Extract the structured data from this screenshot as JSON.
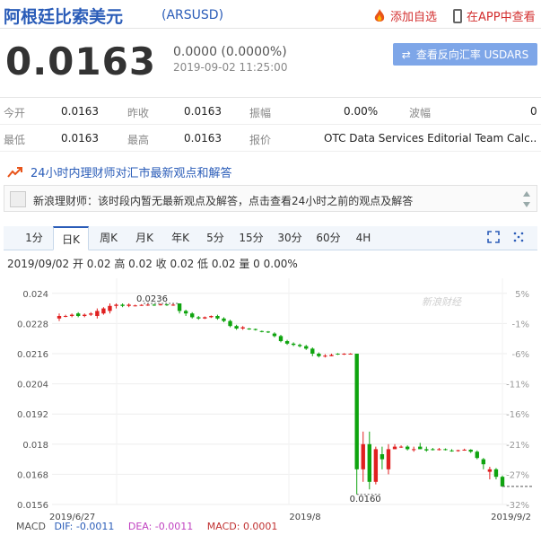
{
  "header": {
    "title": "阿根廷比索美元",
    "code": "(ARSUSD)",
    "add_watch": "添加自选",
    "app_view": "在APP中查看"
  },
  "quote": {
    "price": "0.0163",
    "change": "0.0000 (0.0000%)",
    "time": "2019-09-02 11:25:00",
    "reverse_button": "查看反向汇率 USDARS"
  },
  "stats": {
    "row1": [
      {
        "label": "今开",
        "value": "0.0163"
      },
      {
        "label": "昨收",
        "value": "0.0163"
      },
      {
        "label": "振幅",
        "value": "0.00%"
      },
      {
        "label": "波幅",
        "value": "0"
      }
    ],
    "row2": [
      {
        "label": "最低",
        "value": "0.0163"
      },
      {
        "label": "最高",
        "value": "0.0163"
      },
      {
        "label": "报价",
        "value": "OTC Data Services Editorial Team Calc..."
      }
    ]
  },
  "news": {
    "heading": "24小时内理财师对汇市最新观点和解答",
    "item": "新浪理财师：该时段内暂无最新观点及解答，点击查看24小时之前的观点及解答"
  },
  "tabs": [
    "1分",
    "日K",
    "周K",
    "月K",
    "年K",
    "5分",
    "15分",
    "30分",
    "60分",
    "4H"
  ],
  "active_tab": "日K",
  "chart_info": "2019/09/02 开 0.02 高 0.02 收 0.02 低 0.02 量 0 0.00%",
  "colors": {
    "up": "#e02020",
    "down": "#0fa40f",
    "accent": "#2a5cb8"
  },
  "chart_data": {
    "type": "candlestick",
    "y_ticks": [
      "0.024",
      "0.0228",
      "0.0216",
      "0.0204",
      "0.0192",
      "0.018",
      "0.0168",
      "0.0156"
    ],
    "y_range": [
      0.0156,
      0.0246
    ],
    "pct_ticks": [
      "5%",
      "-1%",
      "-6%",
      "-11%",
      "-16%",
      "-21%",
      "-27%",
      "-32%"
    ],
    "x_labels": [
      "2019/6/27",
      "2019/8",
      "2019/9/2"
    ],
    "annotations": [
      {
        "text": "0.0236",
        "value": 0.0236
      },
      {
        "text": "0.0160",
        "value": 0.016
      }
    ],
    "watermark": "新浪财经",
    "candles": [
      [
        0.023,
        0.0231,
        0.0232,
        0.0229
      ],
      [
        0.0231,
        0.0231,
        0.02315,
        0.02305
      ],
      [
        0.0231,
        0.02315,
        0.0232,
        0.02305
      ],
      [
        0.0232,
        0.0231,
        0.02325,
        0.02305
      ],
      [
        0.0231,
        0.02315,
        0.0232,
        0.02305
      ],
      [
        0.02315,
        0.0232,
        0.02325,
        0.0231
      ],
      [
        0.0231,
        0.0233,
        0.0234,
        0.023
      ],
      [
        0.0232,
        0.0234,
        0.02345,
        0.02315
      ],
      [
        0.0233,
        0.0235,
        0.0236,
        0.0232
      ],
      [
        0.0235,
        0.02355,
        0.0236,
        0.0234
      ],
      [
        0.02355,
        0.0235,
        0.0236,
        0.02345
      ],
      [
        0.0235,
        0.02355,
        0.0236,
        0.02345
      ],
      [
        0.0235,
        0.02352,
        0.02355,
        0.02348
      ],
      [
        0.02352,
        0.02354,
        0.02357,
        0.0235
      ],
      [
        0.02354,
        0.02355,
        0.02358,
        0.0235
      ],
      [
        0.02355,
        0.02354,
        0.02358,
        0.0235
      ],
      [
        0.02355,
        0.02356,
        0.0236,
        0.02352
      ],
      [
        0.02356,
        0.02354,
        0.02358,
        0.0235
      ],
      [
        0.02354,
        0.02355,
        0.02358,
        0.0235
      ],
      [
        0.0236,
        0.0233,
        0.0236,
        0.0232
      ],
      [
        0.0233,
        0.0232,
        0.02335,
        0.0231
      ],
      [
        0.0232,
        0.02305,
        0.02325,
        0.023
      ],
      [
        0.02305,
        0.023,
        0.0231,
        0.02295
      ],
      [
        0.023,
        0.02305,
        0.02308,
        0.02298
      ],
      [
        0.02305,
        0.0231,
        0.02312,
        0.02302
      ],
      [
        0.0231,
        0.023,
        0.02315,
        0.02295
      ],
      [
        0.023,
        0.0229,
        0.02305,
        0.02285
      ],
      [
        0.0229,
        0.0227,
        0.02295,
        0.02265
      ],
      [
        0.0227,
        0.0226,
        0.02275,
        0.02255
      ],
      [
        0.0226,
        0.02265,
        0.0227,
        0.02255
      ],
      [
        0.0226,
        0.02258,
        0.02262,
        0.02255
      ],
      [
        0.02258,
        0.02255,
        0.0226,
        0.02252
      ],
      [
        0.0225,
        0.02248,
        0.02252,
        0.02245
      ],
      [
        0.02248,
        0.02245,
        0.0225,
        0.02242
      ],
      [
        0.0224,
        0.0223,
        0.02245,
        0.02225
      ],
      [
        0.0223,
        0.0221,
        0.02235,
        0.02205
      ],
      [
        0.0221,
        0.022,
        0.02215,
        0.02195
      ],
      [
        0.022,
        0.02195,
        0.02205,
        0.0219
      ],
      [
        0.02195,
        0.0219,
        0.022,
        0.02185
      ],
      [
        0.0219,
        0.0218,
        0.02195,
        0.02175
      ],
      [
        0.0218,
        0.0216,
        0.02185,
        0.0215
      ],
      [
        0.0216,
        0.0215,
        0.02165,
        0.02145
      ],
      [
        0.0215,
        0.02152,
        0.02158,
        0.02145
      ],
      [
        0.0215,
        0.02155,
        0.0216,
        0.0215
      ],
      [
        0.0216,
        0.02158,
        0.02162,
        0.02155
      ],
      [
        0.02158,
        0.0216,
        0.02162,
        0.02155
      ],
      [
        0.0216,
        0.0216,
        0.02162,
        0.02158
      ],
      [
        0.0216,
        0.017,
        0.0216,
        0.016
      ],
      [
        0.017,
        0.018,
        0.0185,
        0.0165
      ],
      [
        0.018,
        0.0165,
        0.0185,
        0.0162
      ],
      [
        0.0165,
        0.0178,
        0.0179,
        0.0164
      ],
      [
        0.0176,
        0.0174,
        0.0179,
        0.017
      ],
      [
        0.017,
        0.0178,
        0.018,
        0.0168
      ],
      [
        0.0178,
        0.0179,
        0.018,
        0.0178
      ],
      [
        0.0179,
        0.0179,
        0.01795,
        0.01785
      ],
      [
        0.0179,
        0.0178,
        0.01795,
        0.01775
      ],
      [
        0.0178,
        0.0178,
        0.0179,
        0.0177
      ],
      [
        0.0179,
        0.0178,
        0.01805,
        0.0178
      ],
      [
        0.0178,
        0.01775,
        0.0179,
        0.0177
      ],
      [
        0.0178,
        0.01778,
        0.01785,
        0.01775
      ],
      [
        0.01778,
        0.0178,
        0.01785,
        0.01775
      ],
      [
        0.0178,
        0.01778,
        0.01783,
        0.01775
      ],
      [
        0.01775,
        0.01774,
        0.0178,
        0.0177
      ],
      [
        0.01774,
        0.01776,
        0.01778,
        0.0177
      ],
      [
        0.01776,
        0.01778,
        0.01782,
        0.01774
      ],
      [
        0.01778,
        0.0177,
        0.0178,
        0.01765
      ],
      [
        0.0177,
        0.01745,
        0.01775,
        0.0174
      ],
      [
        0.0174,
        0.0172,
        0.01745,
        0.017
      ],
      [
        0.0169,
        0.017,
        0.0171,
        0.0166
      ],
      [
        0.017,
        0.0167,
        0.01705,
        0.0166
      ],
      [
        0.0167,
        0.01632,
        0.01675,
        0.0163
      ]
    ]
  },
  "macd": {
    "label": "MACD",
    "dif": "DIF: -0.0011",
    "dea": "DEA: -0.0011",
    "macd": "MACD: 0.0001"
  }
}
